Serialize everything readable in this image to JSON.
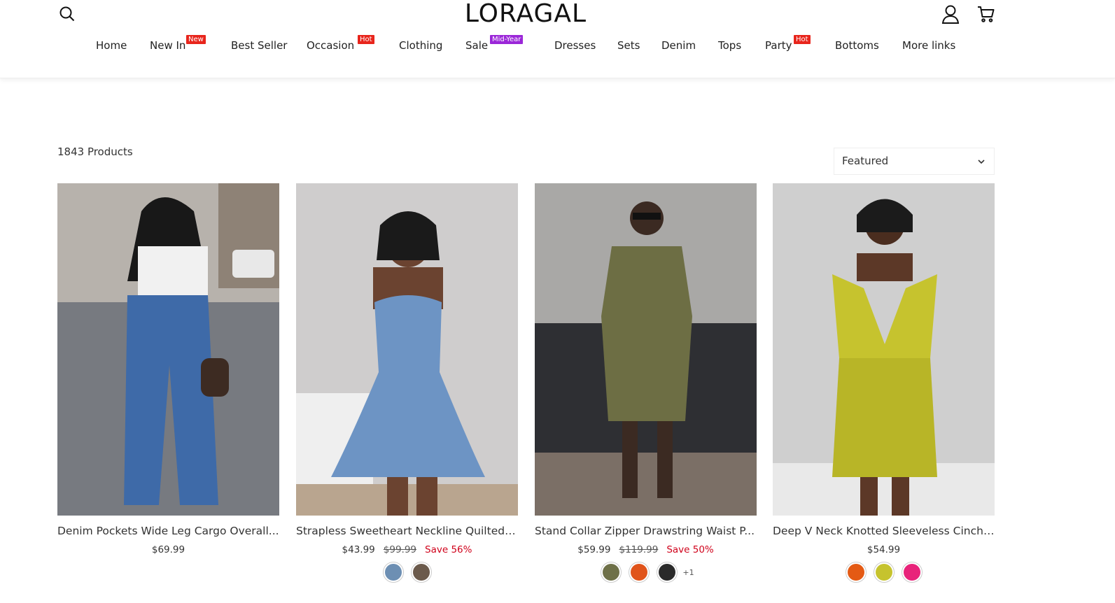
{
  "brand": {
    "logo_text": "LORAGAL"
  },
  "nav": [
    {
      "label": "Home"
    },
    {
      "label": "New In",
      "badge": "New",
      "badge_color": "#e8251c"
    },
    {
      "label": "Best Seller"
    },
    {
      "label": "Occasion",
      "badge": "Hot",
      "badge_color": "#e8251c"
    },
    {
      "label": "Clothing"
    },
    {
      "label": "Sale",
      "badge": "Mid-Year",
      "badge_color": "#9b27d8"
    },
    {
      "label": "Dresses"
    },
    {
      "label": "Sets"
    },
    {
      "label": "Denim"
    },
    {
      "label": "Tops"
    },
    {
      "label": "Party",
      "badge": "Hot",
      "badge_color": "#e8251c"
    },
    {
      "label": "Bottoms"
    },
    {
      "label": "More links"
    }
  ],
  "icons": {
    "search": "search-icon",
    "account": "user-icon",
    "cart": "cart-icon",
    "sort": "chevron-down-icon"
  },
  "listing": {
    "product_count": "1843 Products",
    "sort_selected": "Featured"
  },
  "products": [
    {
      "title": "Denim Pockets Wide Leg Cargo Overall...",
      "price": "$69.99",
      "compare_price": "",
      "save": "",
      "swatches": [],
      "more_swatches": ""
    },
    {
      "title": "Strapless Sweetheart Neckline Quilted ...",
      "price": "$43.99",
      "compare_price": "$99.99",
      "save": "Save 56%",
      "swatches": [
        "#6d8fb3",
        "#6b5a4c"
      ],
      "more_swatches": ""
    },
    {
      "title": "Stand Collar Zipper Drawstring Waist P...",
      "price": "$59.99",
      "compare_price": "$119.99",
      "save": "Save 50%",
      "swatches": [
        "#6e7048",
        "#e0541b",
        "#2a2a2a"
      ],
      "more_swatches": "+1"
    },
    {
      "title": "Deep V Neck Knotted Sleeveless Cinch ...",
      "price": "$54.99",
      "compare_price": "",
      "save": "",
      "swatches": [
        "#e45a14",
        "#c6c32e",
        "#e8237a"
      ],
      "more_swatches": ""
    }
  ],
  "colors": {
    "hot_badge": "#e8251c",
    "sale_badge": "#9b27d8",
    "save_text": "#d0021b"
  }
}
